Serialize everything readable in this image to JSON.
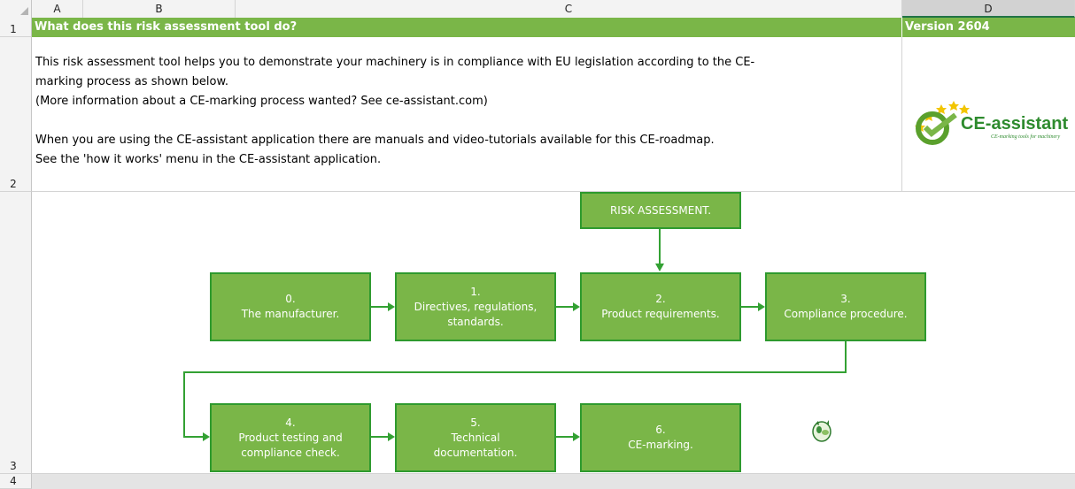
{
  "columns": [
    "A",
    "B",
    "C",
    "D"
  ],
  "rows": [
    "1",
    "2",
    "3",
    "4"
  ],
  "title": "What does this risk assessment tool do?",
  "version": "Version 2604",
  "description": "This risk assessment tool helps you to demonstrate your machinery is in compliance with EU legislation according to the CE-\nmarking process as shown below.\n(More information about a CE-marking process wanted? See ce-assistant.com)\n\nWhen you are using the CE-assistant application there are manuals and video-tutorials available for this CE-roadmap.\nSee the 'how it works' menu in the CE-assistant application.",
  "logo": {
    "brand": "CE-assistant",
    "tagline": "CE-marking tools for machinery"
  },
  "flow": {
    "risk": "RISK ASSESSMENT.",
    "steps": [
      {
        "num": "0.",
        "text": "The manufacturer."
      },
      {
        "num": "1.",
        "text": "Directives, regulations, standards."
      },
      {
        "num": "2.",
        "text": "Product requirements."
      },
      {
        "num": "3.",
        "text": "Compliance procedure."
      },
      {
        "num": "4.",
        "text": "Product testing and compliance check."
      },
      {
        "num": "5.",
        "text": "Technical documentation."
      },
      {
        "num": "6.",
        "text": "CE-marking."
      }
    ]
  },
  "colors": {
    "accent": "#7ab648",
    "border": "#2e9a2e"
  }
}
